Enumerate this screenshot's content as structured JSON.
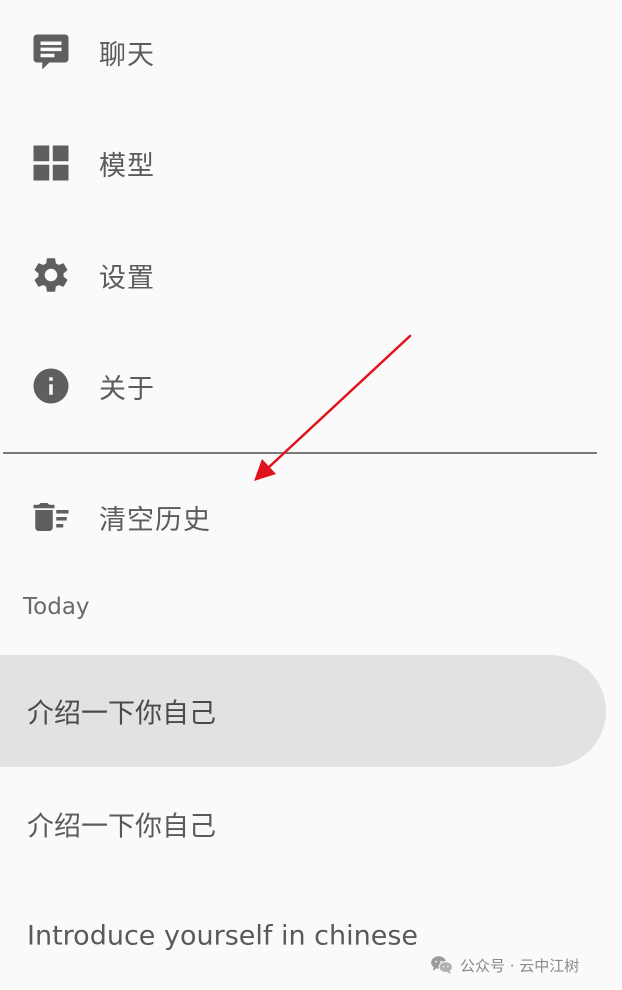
{
  "nav": {
    "items": [
      {
        "label": "聊天",
        "icon": "chat-icon"
      },
      {
        "label": "模型",
        "icon": "grid-icon"
      },
      {
        "label": "设置",
        "icon": "gear-icon"
      },
      {
        "label": "关于",
        "icon": "info-icon"
      }
    ],
    "clear_history": {
      "label": "清空历史",
      "icon": "delete-sweep-icon"
    }
  },
  "history": {
    "section_title": "Today",
    "items": [
      {
        "label": "介绍一下你自己",
        "selected": true
      },
      {
        "label": "介绍一下你自己",
        "selected": false
      },
      {
        "label": "Introduce yourself in chinese",
        "selected": false
      }
    ]
  },
  "annotation": {
    "arrow_color": "#e0141c"
  },
  "watermark": {
    "text": "公众号 · 云中江树",
    "icon": "wechat-icon"
  },
  "colors": {
    "background": "#fafafa",
    "icon": "#5f5f5f",
    "selected_bg": "#e2e2e2",
    "divider": "#7a7a7a"
  }
}
